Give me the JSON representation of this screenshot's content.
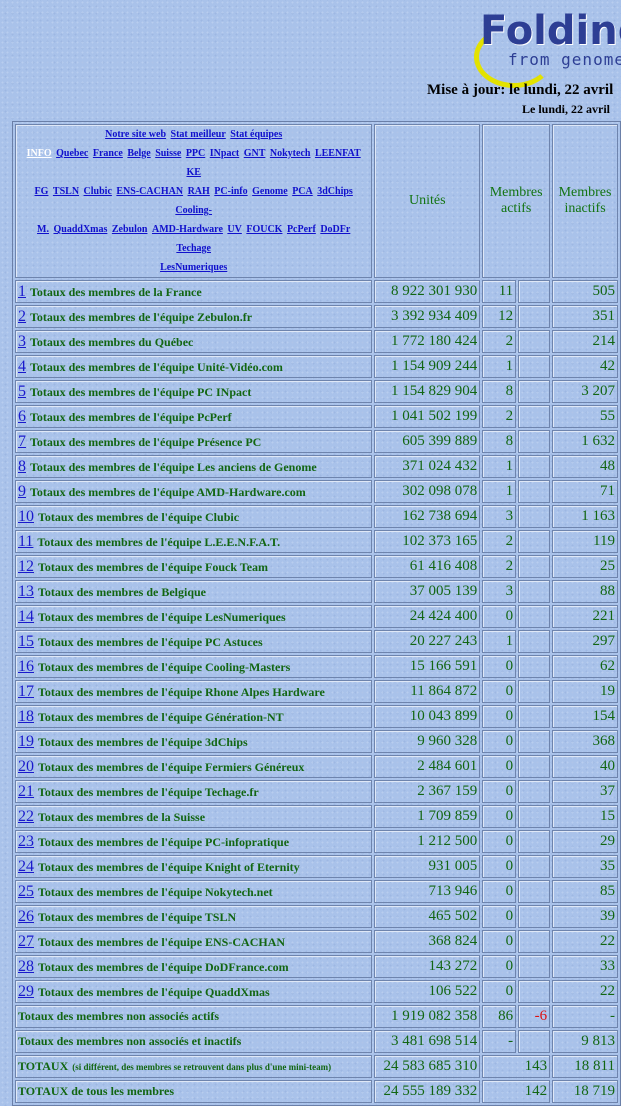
{
  "header": {
    "logo_title": "Folding",
    "logo_subtitle": "from genome",
    "update_line": "Mise à jour: le lundi, 22 avril",
    "update_line2": "Le lundi, 22 avril"
  },
  "links": [
    "Notre site web",
    "Stat meilleur",
    "Stat équipes",
    "INFO",
    "Quebec",
    "France",
    "Belge",
    "Suisse",
    "PPC",
    "INpact",
    "GNT",
    "Nokytech",
    "LEENFAT",
    "KE",
    "FG",
    "TSLN",
    "Clubic",
    "ENS-CACHAN",
    "RAH",
    "PC-info",
    "Genome",
    "PCA",
    "3dChips",
    "Cooling-",
    "M.",
    "QuaddXmas",
    "Zebulon",
    "AMD-Hardware",
    "UV",
    "FOUCK",
    "PcPerf",
    "DoDFr",
    "Techage",
    "LesNumeriques"
  ],
  "columns": {
    "units": "Unités",
    "active": "Membres actifs",
    "inactive": "Membres inactifs"
  },
  "rows": [
    {
      "rank": "1",
      "name": "Totaux des membres de la France",
      "units": "8 922 301 930",
      "active": "11",
      "delta": "",
      "inactive": "505"
    },
    {
      "rank": "2",
      "name": "Totaux des membres de l'équipe Zebulon.fr",
      "units": "3 392 934 409",
      "active": "12",
      "delta": "",
      "inactive": "351"
    },
    {
      "rank": "3",
      "name": "Totaux des membres du Québec",
      "units": "1 772 180 424",
      "active": "2",
      "delta": "",
      "inactive": "214"
    },
    {
      "rank": "4",
      "name": "Totaux des membres de l'équipe Unité-Vidéo.com",
      "units": "1 154 909 244",
      "active": "1",
      "delta": "",
      "inactive": "42"
    },
    {
      "rank": "5",
      "name": "Totaux des membres de l'équipe PC INpact",
      "units": "1 154 829 904",
      "active": "8",
      "delta": "",
      "inactive": "3 207"
    },
    {
      "rank": "6",
      "name": "Totaux des membres de l'équipe PcPerf",
      "units": "1 041 502 199",
      "active": "2",
      "delta": "",
      "inactive": "55"
    },
    {
      "rank": "7",
      "name": "Totaux des membres de l'équipe Présence PC",
      "units": "605 399 889",
      "active": "8",
      "delta": "",
      "inactive": "1 632"
    },
    {
      "rank": "8",
      "name": "Totaux des membres de l'équipe Les anciens de Genome",
      "units": "371 024 432",
      "active": "1",
      "delta": "",
      "inactive": "48"
    },
    {
      "rank": "9",
      "name": "Totaux des membres de l'équipe AMD-Hardware.com",
      "units": "302 098 078",
      "active": "1",
      "delta": "",
      "inactive": "71"
    },
    {
      "rank": "10",
      "name": "Totaux des membres de l'équipe Clubic",
      "units": "162 738 694",
      "active": "3",
      "delta": "",
      "inactive": "1 163"
    },
    {
      "rank": "11",
      "name": "Totaux des membres de l'équipe L.E.E.N.F.A.T.",
      "units": "102 373 165",
      "active": "2",
      "delta": "",
      "inactive": "119"
    },
    {
      "rank": "12",
      "name": "Totaux des membres de l'équipe Fouck Team",
      "units": "61 416 408",
      "active": "2",
      "delta": "",
      "inactive": "25"
    },
    {
      "rank": "13",
      "name": "Totaux des membres de Belgique",
      "units": "37 005 139",
      "active": "3",
      "delta": "",
      "inactive": "88"
    },
    {
      "rank": "14",
      "name": "Totaux des membres de l'équipe LesNumeriques",
      "units": "24 424 400",
      "active": "0",
      "delta": "",
      "inactive": "221"
    },
    {
      "rank": "15",
      "name": "Totaux des membres de l'équipe PC Astuces",
      "units": "20 227 243",
      "active": "1",
      "delta": "",
      "inactive": "297"
    },
    {
      "rank": "16",
      "name": "Totaux des membres de l'équipe Cooling-Masters",
      "units": "15 166 591",
      "active": "0",
      "delta": "",
      "inactive": "62"
    },
    {
      "rank": "17",
      "name": "Totaux des membres de l'équipe Rhone Alpes Hardware",
      "units": "11 864 872",
      "active": "0",
      "delta": "",
      "inactive": "19"
    },
    {
      "rank": "18",
      "name": "Totaux des membres de l'équipe Génération-NT",
      "units": "10 043 899",
      "active": "0",
      "delta": "",
      "inactive": "154"
    },
    {
      "rank": "19",
      "name": "Totaux des membres de l'équipe 3dChips",
      "units": "9 960 328",
      "active": "0",
      "delta": "",
      "inactive": "368"
    },
    {
      "rank": "20",
      "name": "Totaux des membres de l'équipe Fermiers Généreux",
      "units": "2 484 601",
      "active": "0",
      "delta": "",
      "inactive": "40"
    },
    {
      "rank": "21",
      "name": "Totaux des membres de l'équipe Techage.fr",
      "units": "2 367 159",
      "active": "0",
      "delta": "",
      "inactive": "37"
    },
    {
      "rank": "22",
      "name": "Totaux des membres de la Suisse",
      "units": "1 709 859",
      "active": "0",
      "delta": "",
      "inactive": "15"
    },
    {
      "rank": "23",
      "name": "Totaux des membres de l'équipe PC-infopratique",
      "units": "1 212 500",
      "active": "0",
      "delta": "",
      "inactive": "29"
    },
    {
      "rank": "24",
      "name": "Totaux des membres de l'équipe Knight of Eternity",
      "units": "931 005",
      "active": "0",
      "delta": "",
      "inactive": "35"
    },
    {
      "rank": "25",
      "name": "Totaux des membres de l'équipe Nokytech.net",
      "units": "713 946",
      "active": "0",
      "delta": "",
      "inactive": "85"
    },
    {
      "rank": "26",
      "name": "Totaux des membres de l'équipe TSLN",
      "units": "465 502",
      "active": "0",
      "delta": "",
      "inactive": "39"
    },
    {
      "rank": "27",
      "name": "Totaux des membres de l'équipe ENS-CACHAN",
      "units": "368 824",
      "active": "0",
      "delta": "",
      "inactive": "22"
    },
    {
      "rank": "28",
      "name": "Totaux des membres de l'équipe DoDFrance.com",
      "units": "143 272",
      "active": "0",
      "delta": "",
      "inactive": "33"
    },
    {
      "rank": "29",
      "name": "Totaux des membres de l'équipe QuaddXmas",
      "units": "106 522",
      "active": "0",
      "delta": "",
      "inactive": "22"
    }
  ],
  "totals": [
    {
      "name": "Totaux des membres non associés actifs",
      "note": "",
      "units": "1 919 082 358",
      "active": "86",
      "delta": "-6",
      "inactive": "-"
    },
    {
      "name": "Totaux des membres non associés et inactifs",
      "note": "",
      "units": "3 481 698 514",
      "active": "-",
      "delta": "",
      "inactive": "9 813"
    },
    {
      "name": "TOTAUX",
      "note": "(si différent, des membres se retrouvent dans plus d'une mini-team)",
      "units": "24 583 685 310",
      "active": "143",
      "delta": "",
      "inactive": "18 811"
    },
    {
      "name": "TOTAUX de tous les membres",
      "note": "",
      "units": "24 555 189 332",
      "active": "142",
      "delta": "",
      "inactive": "18 719"
    }
  ]
}
